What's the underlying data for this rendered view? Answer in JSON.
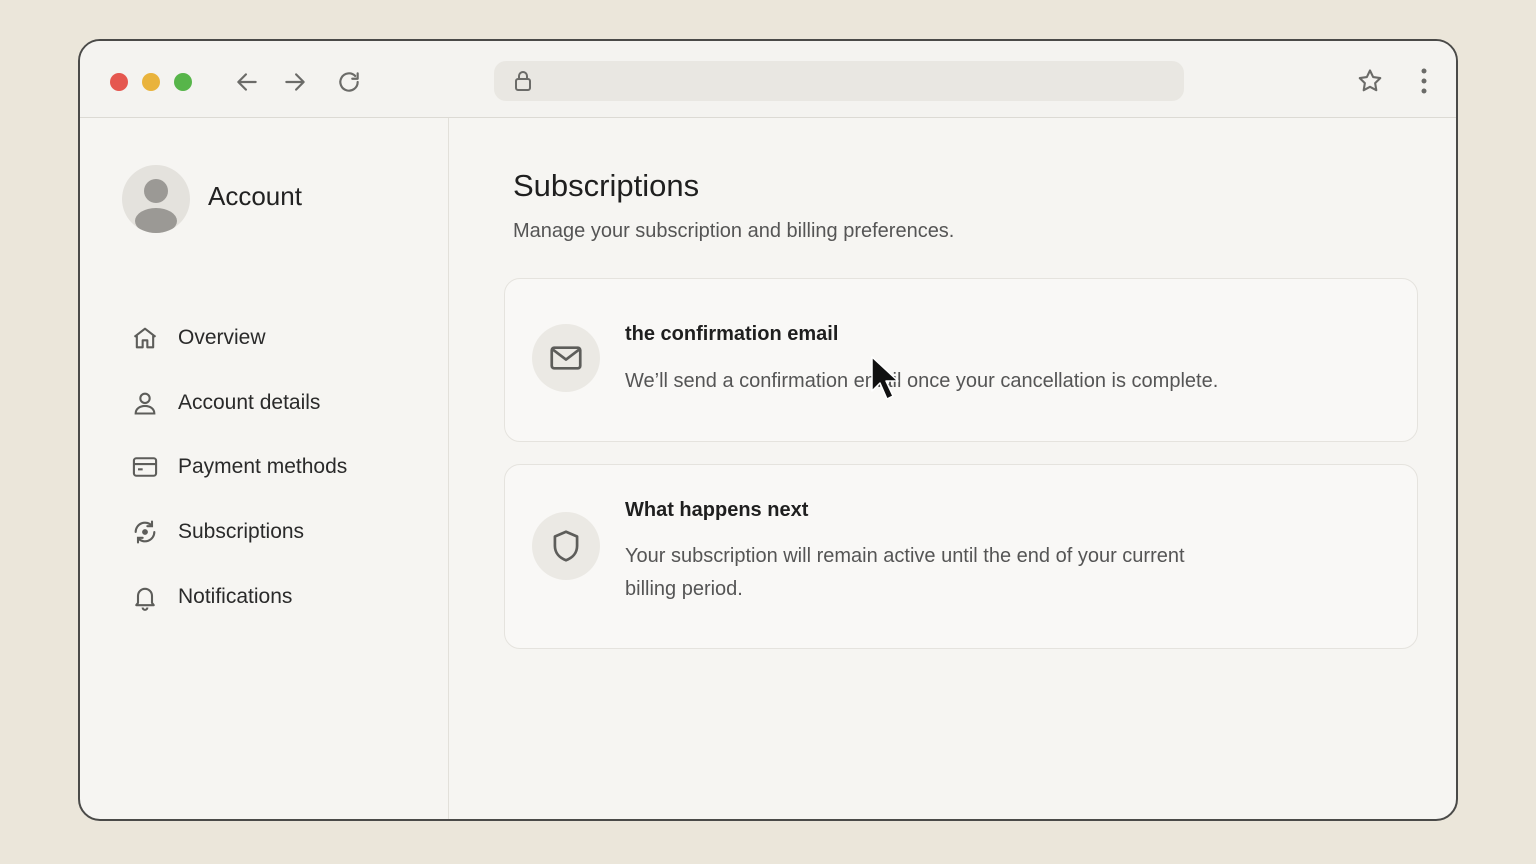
{
  "browser": {
    "address_value": "",
    "icons": [
      "back-arrow-icon",
      "forward-arrow-icon",
      "reload-icon",
      "lock-icon",
      "star-icon",
      "more-vertical-icon"
    ]
  },
  "sidebar": {
    "account_title": "Account",
    "items": [
      {
        "label": "Overview",
        "icon": "home-icon"
      },
      {
        "label": "Account details",
        "icon": "user-icon"
      },
      {
        "label": "Payment methods",
        "icon": "credit-card-icon"
      },
      {
        "label": "Subscriptions",
        "icon": "subscriptions-icon"
      },
      {
        "label": "Notifications",
        "icon": "bell-icon"
      }
    ]
  },
  "main": {
    "title": "Subscriptions",
    "subtitle": "Manage your subscription and billing preferences.",
    "cards": [
      {
        "icon": "mail-icon",
        "title": "the confirmation email",
        "body": "We’ll send a confirmation email once your cancellation is complete."
      },
      {
        "icon": "shield-icon",
        "title": "What happens next",
        "body": "Your subscription will remain active until the end of your current billing period."
      }
    ]
  }
}
